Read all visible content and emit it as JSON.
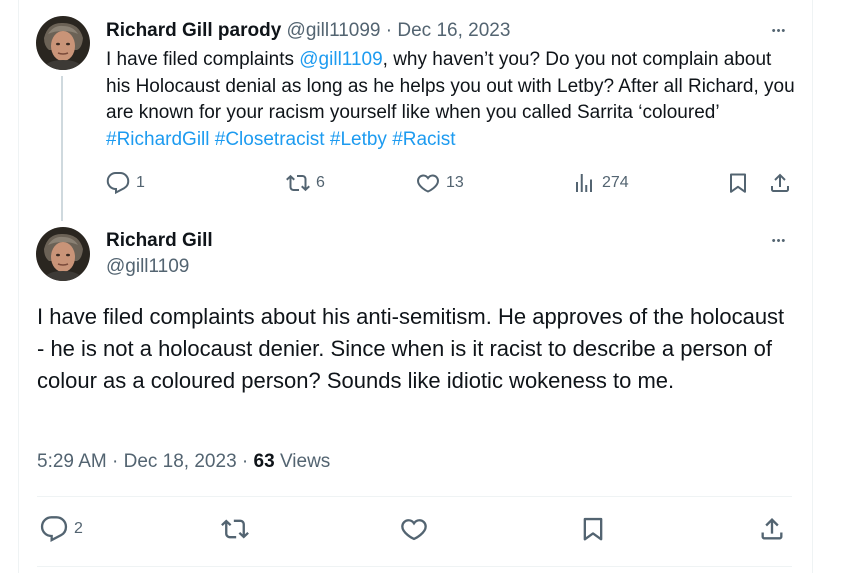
{
  "reply_tweet": {
    "display_name": "Richard Gill parody",
    "handle": "@gill11099",
    "separator": "·",
    "date": "Dec 16, 2023",
    "more_label": "•••",
    "text_1": "I have filed complaints ",
    "mention": "@gill1109",
    "text_2": ", why haven’t you? Do you not complain about his Holocaust denial as long as he helps you out with Letby? After all Richard, you are known for your racism yourself like when you called Sarrita ‘coloured’ ",
    "hashtags": [
      "#RichardGill",
      "#Closetracist",
      "#Letby",
      "#Racist"
    ],
    "replies": "1",
    "reposts": "6",
    "likes": "13",
    "views": "274"
  },
  "main_tweet": {
    "display_name": "Richard Gill",
    "handle": "@gill1109",
    "more_label": "•••",
    "text": "I have filed complaints about his anti-semitism. He approves of the holocaust - he is not a holocaust denier. Since when is it racist to describe a person of colour as a coloured person? Sounds like idiotic wokeness to me.",
    "time": "5:29 AM",
    "separator": "·",
    "date": "Dec 18, 2023",
    "views_count": "63",
    "views_label": "Views",
    "replies": "2"
  },
  "colors": {
    "link": "#1d9bf0",
    "muted": "#536471",
    "text": "#0f1419",
    "border": "#eff3f4"
  },
  "icons": [
    "reply-icon",
    "repost-icon",
    "like-icon",
    "views-icon",
    "bookmark-icon",
    "share-icon",
    "more-icon"
  ]
}
